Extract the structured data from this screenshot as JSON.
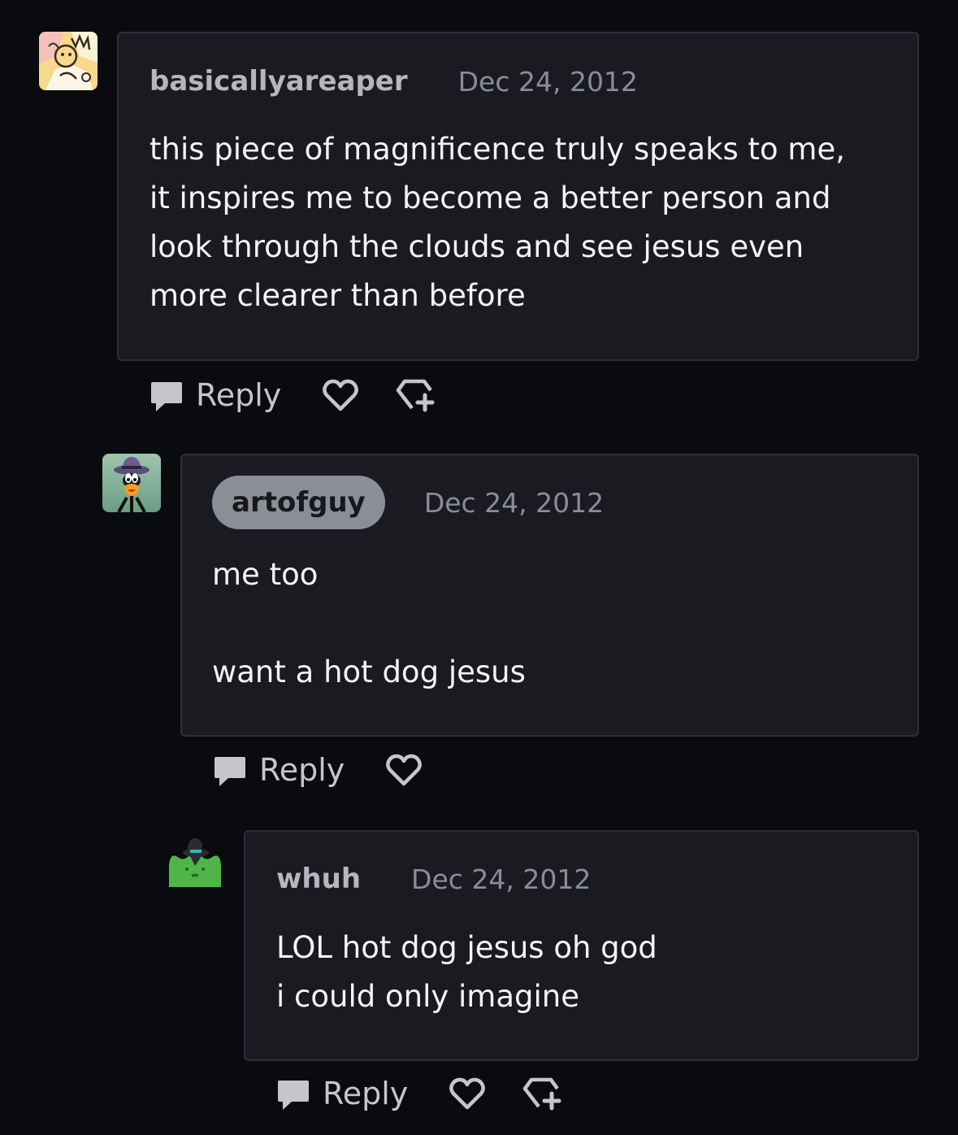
{
  "colors": {
    "background": "#0a0b0f",
    "card": "#191b20",
    "card_border": "#2c2f35",
    "username": "#b5b7bd",
    "op_pill": "#8c8e96",
    "date": "#8a8d94",
    "icon": "#c4c6cb"
  },
  "comments": [
    {
      "username": "basicallyareaper",
      "date": "Dec 24, 2012",
      "body": "this piece of magnificence truly speaks to me,\nit inspires me to become a better person and\nlook through the clouds and see jesus even\nmore clearer than before",
      "reply_label": "Reply",
      "actions": [
        "speech-bubble-icon",
        "heart-icon",
        "gem-plus-icon"
      ]
    },
    {
      "username": "artofguy",
      "date": "Dec 24, 2012",
      "body": "me too\n\nwant a hot dog jesus",
      "reply_label": "Reply",
      "actions": [
        "speech-bubble-icon",
        "heart-icon"
      ]
    },
    {
      "username": "whuh",
      "date": "Dec 24, 2012",
      "body": "LOL hot dog jesus oh god\ni could only imagine",
      "reply_label": "Reply",
      "actions": [
        "speech-bubble-icon",
        "heart-icon",
        "gem-plus-icon"
      ]
    }
  ]
}
